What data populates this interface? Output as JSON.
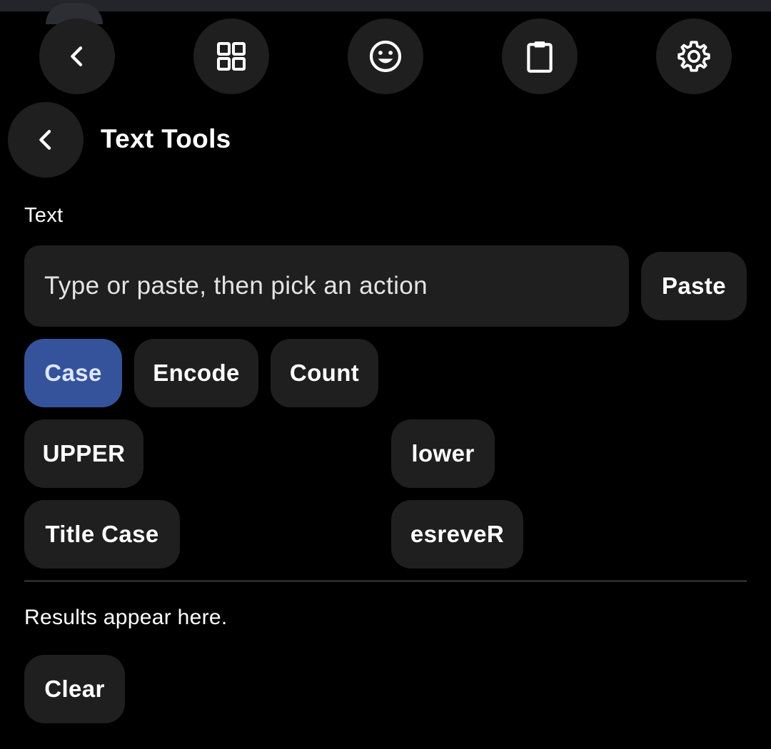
{
  "toolbar": {
    "buttons": [
      {
        "icon": "chevron-left-icon"
      },
      {
        "icon": "grid-icon"
      },
      {
        "icon": "emoji-icon"
      },
      {
        "icon": "clipboard-icon"
      },
      {
        "icon": "gear-icon"
      }
    ]
  },
  "header": {
    "title": "Text Tools",
    "back_icon": "chevron-left-icon"
  },
  "input": {
    "label": "Text",
    "value": "",
    "placeholder": "Type or paste, then pick an action",
    "paste_label": "Paste"
  },
  "tabs": [
    {
      "label": "Case",
      "selected": true
    },
    {
      "label": "Encode",
      "selected": false
    },
    {
      "label": "Count",
      "selected": false
    }
  ],
  "actions": [
    {
      "label": "UPPER"
    },
    {
      "label": "lower"
    },
    {
      "label": "Title Case"
    },
    {
      "label": "esreveR"
    }
  ],
  "results": {
    "text": "Results appear here.",
    "clear_label": "Clear"
  },
  "colors": {
    "background": "#000000",
    "surface": "#1f1f1f",
    "accent": "#34539a",
    "accent_text": "#dfe6ff"
  }
}
